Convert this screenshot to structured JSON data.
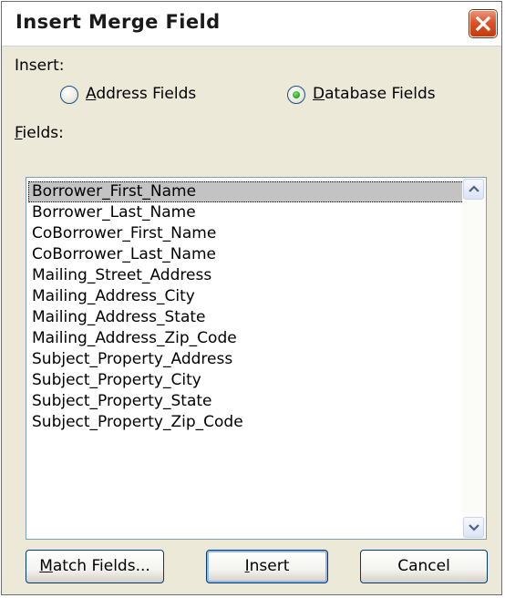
{
  "dialog": {
    "title": "Insert Merge Field",
    "close_icon": "close-icon"
  },
  "insert_group": {
    "label": "Insert:",
    "options": [
      {
        "label_key": "A",
        "label_rest": "ddress Fields",
        "selected": false
      },
      {
        "label_key": "D",
        "label_rest": "atabase Fields",
        "selected": true
      }
    ]
  },
  "fields": {
    "label_key": "F",
    "label_rest": "ields:",
    "items": [
      "Borrower_First_Name",
      "Borrower_Last_Name",
      "CoBorrower_First_Name",
      "CoBorrower_Last_Name",
      "Mailing_Street_Address",
      "Mailing_Address_City",
      "Mailing_Address_State",
      "Mailing_Address_Zip_Code",
      "Subject_Property_Address",
      "Subject_Property_City",
      "Subject_Property_State",
      "Subject_Property_Zip_Code"
    ],
    "selected_index": 0
  },
  "buttons": {
    "match": {
      "key": "M",
      "rest": "atch Fields..."
    },
    "insert": {
      "key": "I",
      "rest": "nsert"
    },
    "cancel": {
      "label": "Cancel"
    }
  },
  "colors": {
    "selection": "#c3c3c3",
    "radio_selected": "#2fae22",
    "close_button": "#d9542b"
  }
}
